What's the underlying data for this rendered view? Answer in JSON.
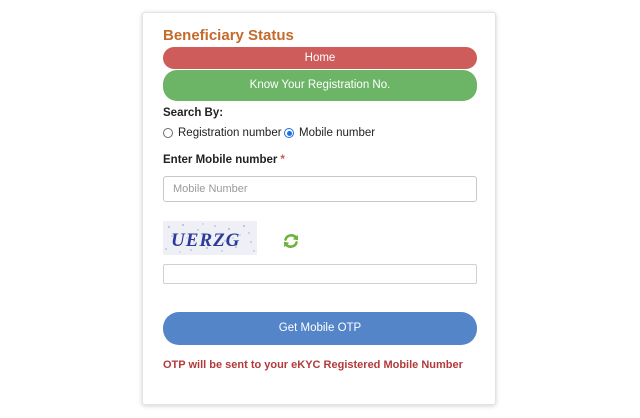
{
  "page": {
    "title": "Beneficiary Status",
    "home_button": "Home",
    "know_registration_button": "Know Your Registration No.",
    "search_by_label": "Search By:",
    "radio_options": [
      {
        "label": "Registration number",
        "checked": false
      },
      {
        "label": "Mobile number",
        "checked": true
      }
    ],
    "mobile_field_label": "Enter Mobile number",
    "required_mark": "*",
    "mobile_placeholder": "Mobile Number",
    "mobile_value": "",
    "captcha_text": "UERZG",
    "captcha_input_value": "",
    "otp_button": "Get Mobile OTP",
    "otp_note": "OTP will be sent to your eKYC Registered Mobile Number"
  },
  "icons": {
    "refresh": "refresh-icon"
  },
  "colors": {
    "title": "#c46a2a",
    "home": "#cd5c5a",
    "know": "#6cb466",
    "otp": "#5385c8",
    "note": "#b23a3a",
    "radio_checked": "#1f6fe0"
  }
}
